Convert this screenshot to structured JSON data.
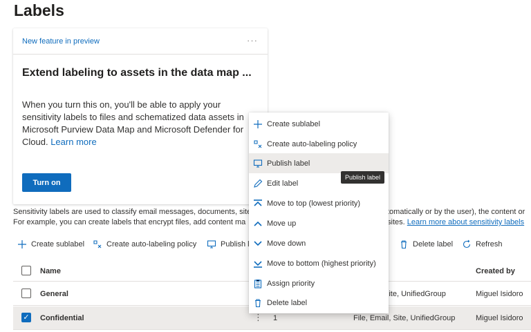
{
  "page": {
    "title": "Labels"
  },
  "card": {
    "badge": "New feature in preview",
    "more": "···",
    "heading": "Extend labeling to assets in the data map ...",
    "body": "When you turn this on, you'll be able to apply your sensitivity labels to files and schematized data assets in Microsoft Purview Data Map and Microsoft Defender for Cloud.",
    "learn_more": "Learn more",
    "turn_on": "Turn on"
  },
  "description": {
    "line1": "Sensitivity labels are used to classify email messages, documents, site",
    "line2": "For example, you can create labels that encrypt files, add content ma",
    "line1_right": "tomatically or by the user), the content or",
    "line2_right_prefix": "sites.",
    "learn_more": "Learn more about sensitivity labels"
  },
  "toolbar": {
    "create_sublabel": "Create sublabel",
    "create_auto": "Create auto-labeling policy",
    "publish": "Publish l",
    "delete": "Delete label",
    "refresh": "Refresh"
  },
  "table": {
    "headers": {
      "name": "Name",
      "created_by": "Created by"
    },
    "rows": [
      {
        "name": "General",
        "priority": "",
        "scope": "Site, UnifiedGroup",
        "created_by": "Miguel Isidoro",
        "selected": false
      },
      {
        "name": "Confidential",
        "priority": "1",
        "scope": "File, Email, Site, UnifiedGroup",
        "created_by": "Miguel Isidoro",
        "selected": true
      }
    ]
  },
  "context_menu": {
    "items": [
      {
        "label": "Create sublabel",
        "icon": "plus-icon"
      },
      {
        "label": "Create auto-labeling policy",
        "icon": "auto-label-icon"
      },
      {
        "label": "Publish label",
        "icon": "publish-icon"
      },
      {
        "label": "Edit label",
        "icon": "pencil-icon"
      },
      {
        "label": "Move to top (lowest priority)",
        "icon": "move-top-icon"
      },
      {
        "label": "Move up",
        "icon": "chevron-up-icon"
      },
      {
        "label": "Move down",
        "icon": "chevron-down-icon"
      },
      {
        "label": "Move to bottom (highest priority)",
        "icon": "move-bottom-icon"
      },
      {
        "label": "Assign priority",
        "icon": "clipboard-icon"
      },
      {
        "label": "Delete label",
        "icon": "trash-icon"
      }
    ],
    "hovered_index": 2
  },
  "tooltip": {
    "text": "Publish label"
  },
  "colors": {
    "accent": "#0f6cbd",
    "selected_row": "#edebe9",
    "text": "#323130"
  }
}
